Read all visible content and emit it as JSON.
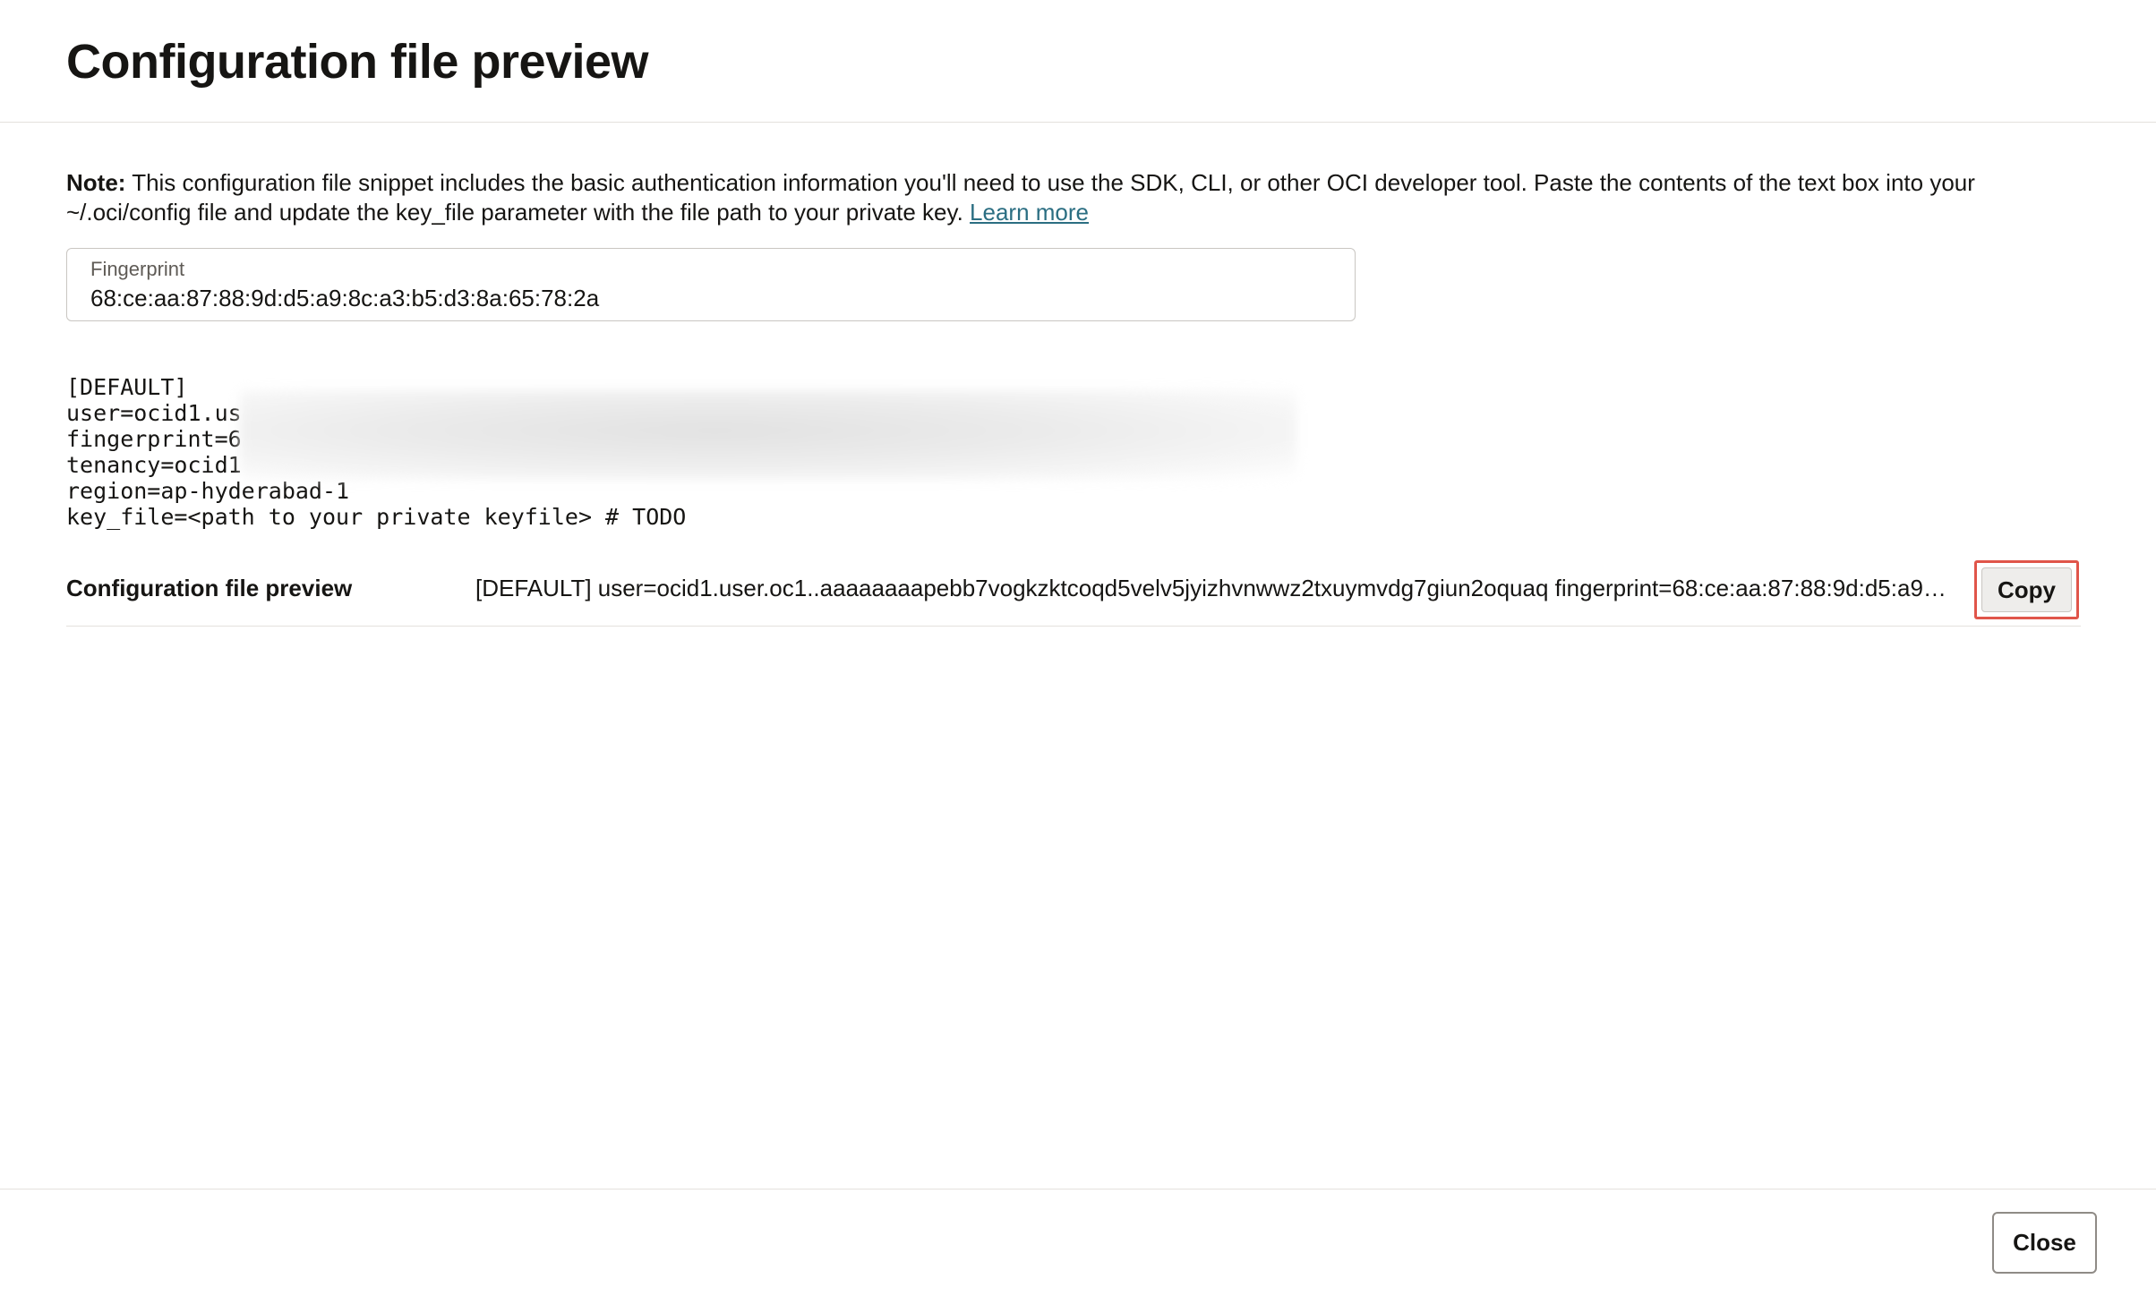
{
  "dialog": {
    "title": "Configuration file preview"
  },
  "note": {
    "label": "Note:",
    "text": " This configuration file snippet includes the basic authentication information you'll need to use the SDK, CLI, or other OCI developer tool. Paste the contents of the text box into your ~/.oci/config file and update the key_file parameter with the file path to your private key. ",
    "link_text": "Learn more"
  },
  "fingerprint": {
    "label": "Fingerprint",
    "value": "68:ce:aa:87:88:9d:d5:a9:8c:a3:b5:d3:8a:65:78:2a"
  },
  "config_code": {
    "lines": [
      "[DEFAULT]",
      "user=ocid1.us",
      "fingerprint=6",
      "tenancy=ocid1",
      "region=ap-hyderabad-1",
      "key_file=<path to your private keyfile> # TODO"
    ]
  },
  "preview_row": {
    "label": "Configuration file preview",
    "value": "[DEFAULT] user=ocid1.user.oc1..aaaaaaaapebb7vogkzktcoqd5velv5jyizhvnwwz2txuymvdg7giun2oquaq fingerprint=68:ce:aa:87:88:9d:d5:a9:8...",
    "copy_label": "Copy"
  },
  "footer": {
    "close_label": "Close"
  },
  "colors": {
    "link": "#2b6e82",
    "highlight": "#e0554a",
    "text": "#161513",
    "border": "#e4e1dd"
  }
}
